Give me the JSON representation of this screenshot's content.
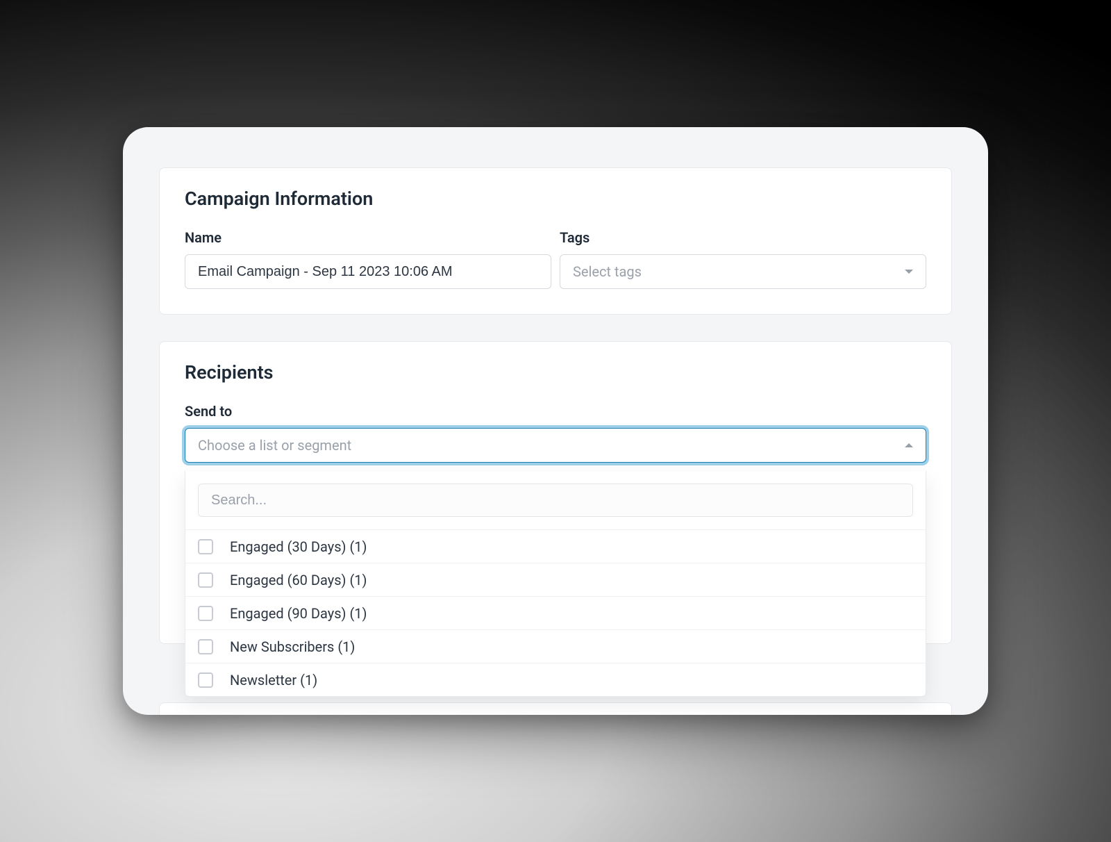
{
  "campaign_info": {
    "title": "Campaign Information",
    "name_label": "Name",
    "name_value": "Email Campaign - Sep 11 2023 10:06 AM",
    "tags_label": "Tags",
    "tags_placeholder": "Select tags"
  },
  "recipients": {
    "title": "Recipients",
    "send_to_label": "Send to",
    "select_placeholder": "Choose a list or segment",
    "search_placeholder": "Search...",
    "options": [
      {
        "label": "Engaged (30 Days) (1)"
      },
      {
        "label": "Engaged (60 Days) (1)"
      },
      {
        "label": "Engaged (90 Days) (1)"
      },
      {
        "label": "New Subscribers (1)"
      },
      {
        "label": "Newsletter (1)"
      }
    ]
  }
}
